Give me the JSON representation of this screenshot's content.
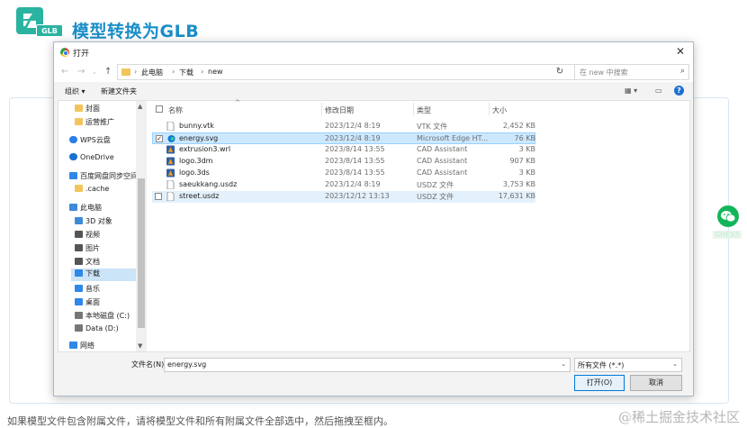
{
  "header": {
    "logo_badge": "GLB",
    "title": "模型转换为GLB"
  },
  "dialog": {
    "title": "打开",
    "nav": {
      "breadcrumb": [
        "此电脑",
        "下载",
        "new"
      ],
      "search_placeholder": "在 new 中搜索"
    },
    "toolbar": {
      "organize": "组织 ▾",
      "new_folder": "新建文件夹"
    },
    "sidebar": {
      "items": [
        {
          "label": "封面",
          "icon": "folder-icon",
          "color": "#f2c55c"
        },
        {
          "label": "运营推广",
          "icon": "folder-icon",
          "color": "#f2c55c"
        },
        {
          "label": "WPS云盘",
          "icon": "cloud-icon",
          "color": "#2b7de9"
        },
        {
          "label": "OneDrive",
          "icon": "cloud-icon",
          "color": "#1a6fd1"
        },
        {
          "label": "百度网盘同步空间",
          "icon": "baidu-icon",
          "color": "#2f87e8"
        },
        {
          "label": ".cache",
          "icon": "folder-icon",
          "color": "#f2c55c"
        },
        {
          "label": "此电脑",
          "icon": "computer-icon",
          "color": "#3f8ad8"
        },
        {
          "label": "3D 对象",
          "icon": "cube-icon",
          "color": "#3f8ad8"
        },
        {
          "label": "视频",
          "icon": "video-icon",
          "color": "#555555"
        },
        {
          "label": "图片",
          "icon": "image-icon",
          "color": "#555555"
        },
        {
          "label": "文档",
          "icon": "doc-icon",
          "color": "#555555"
        },
        {
          "label": "下载",
          "icon": "download-icon",
          "color": "#2f87e8"
        },
        {
          "label": "音乐",
          "icon": "music-icon",
          "color": "#2f87e8"
        },
        {
          "label": "桌面",
          "icon": "desktop-icon",
          "color": "#2f87e8"
        },
        {
          "label": "本地磁盘 (C:)",
          "icon": "disk-icon",
          "color": "#777777"
        },
        {
          "label": "Data (D:)",
          "icon": "disk-icon",
          "color": "#777777"
        },
        {
          "label": "网络",
          "icon": "network-icon",
          "color": "#2f87e8"
        }
      ]
    },
    "columns": {
      "name": "名称",
      "modified": "修改日期",
      "type": "类型",
      "size": "大小"
    },
    "files": [
      {
        "name": "bunny.vtk",
        "modified": "2023/12/4 8:19",
        "type": "VTK 文件",
        "size": "2,452 KB",
        "icon": "file-icon",
        "checked": false
      },
      {
        "name": "energy.svg",
        "modified": "2023/12/4 8:19",
        "type": "Microsoft Edge HT...",
        "size": "76 KB",
        "icon": "edge-icon",
        "checked": true
      },
      {
        "name": "extrusion3.wrl",
        "modified": "2023/8/14 13:55",
        "type": "CAD Assistant",
        "size": "3 KB",
        "icon": "cad-icon",
        "checked": false
      },
      {
        "name": "logo.3dm",
        "modified": "2023/8/14 13:55",
        "type": "CAD Assistant",
        "size": "907 KB",
        "icon": "cad-icon",
        "checked": false
      },
      {
        "name": "logo.3ds",
        "modified": "2023/8/14 13:55",
        "type": "CAD Assistant",
        "size": "3 KB",
        "icon": "cad-icon",
        "checked": false
      },
      {
        "name": "saeukkang.usdz",
        "modified": "2023/12/4 8:19",
        "type": "USDZ 文件",
        "size": "3,753 KB",
        "icon": "file-icon",
        "checked": false
      },
      {
        "name": "street.usdz",
        "modified": "2023/12/12 13:13",
        "type": "USDZ 文件",
        "size": "17,631 KB",
        "icon": "file-icon",
        "checked": false
      }
    ],
    "filename_label": "文件名(N):",
    "filename_value": "energy.svg",
    "filetype_value": "所有文件 (*.*)",
    "open_button": "打开(O)",
    "cancel_button": "取消"
  },
  "footer": {
    "instructions": "如果模型文件包含附属文件，请将模型文件和所有附属文件全部选中，然后拖拽至框内。",
    "watermark": "@稀土掘金技术社区"
  }
}
